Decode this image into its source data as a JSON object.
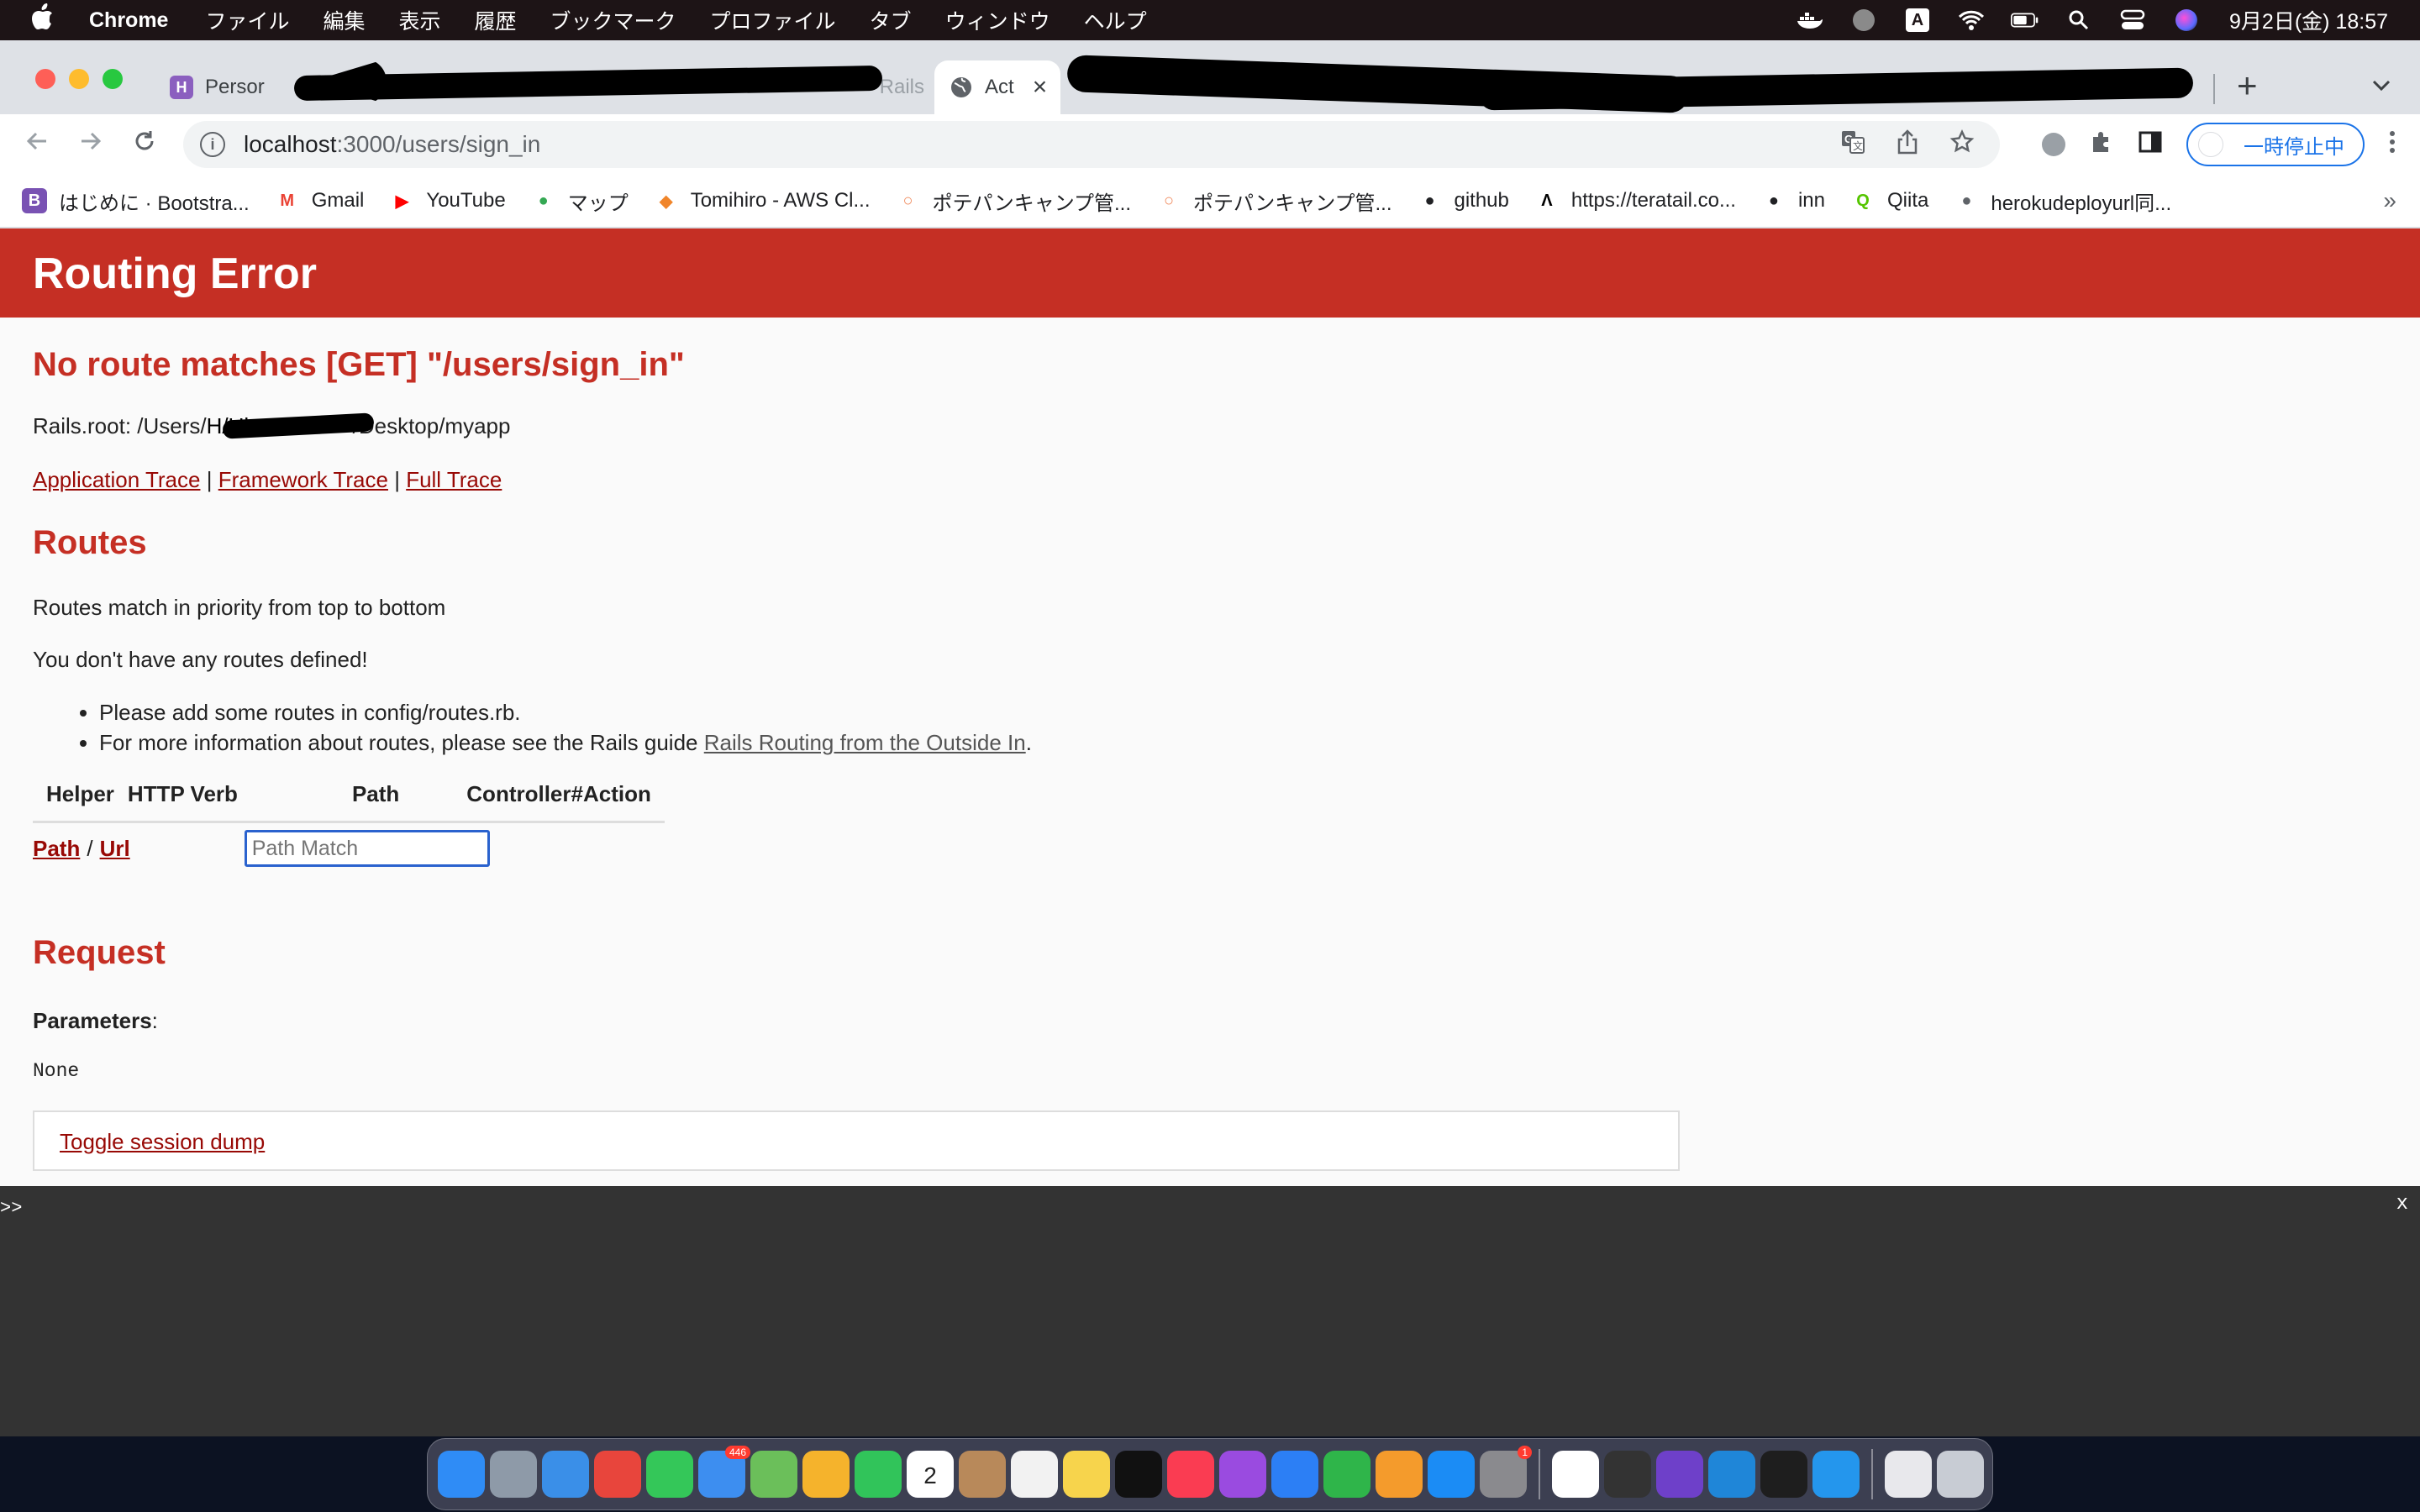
{
  "menubar": {
    "app_name": "Chrome",
    "items": [
      "ファイル",
      "編集",
      "表示",
      "履歴",
      "ブックマーク",
      "プロファイル",
      "タブ",
      "ウィンドウ",
      "ヘルプ"
    ],
    "datetime": "9月2日(金)  18:57",
    "status_icons": [
      "docker-icon",
      "status-circle-icon",
      "input-source-icon",
      "wifi-icon",
      "battery-icon",
      "spotlight-icon",
      "control-center-icon",
      "siri-icon"
    ],
    "input_source": "A"
  },
  "tabs": [
    {
      "label": "Persor",
      "favicon": "H"
    },
    {
      "label": "Rails",
      "favicon": ""
    },
    {
      "label": "Act",
      "favicon": "globe"
    }
  ],
  "address_bar": {
    "host": "localhost",
    "path": ":3000/users/sign_in"
  },
  "profile_button": "一時停止中",
  "bookmarks": [
    {
      "label": "はじめに · Bootstra...",
      "icon": "B",
      "color": "#7952b3"
    },
    {
      "label": "Gmail",
      "icon": "M",
      "color": "#ea4335"
    },
    {
      "label": "YouTube",
      "icon": "▶",
      "color": "#ff0000"
    },
    {
      "label": "マップ",
      "icon": "●",
      "color": "#34a853"
    },
    {
      "label": "Tomihiro - AWS Cl...",
      "icon": "◆",
      "color": "#f0852a"
    },
    {
      "label": "ポテパンキャンプ管...",
      "icon": "○",
      "color": "#f08a5d"
    },
    {
      "label": "ポテパンキャンプ管...",
      "icon": "○",
      "color": "#f08a5d"
    },
    {
      "label": "github",
      "icon": "●",
      "color": "#202124"
    },
    {
      "label": "https://teratail.co...",
      "icon": "Λ",
      "color": "#000000"
    },
    {
      "label": "inn",
      "icon": "●",
      "color": "#202124"
    },
    {
      "label": "Qiita",
      "icon": "Q",
      "color": "#55c500"
    },
    {
      "label": "herokudeployurl同...",
      "icon": "●",
      "color": "#5f6368"
    }
  ],
  "bookmarks_overflow": "»",
  "page": {
    "header": "Routing Error",
    "title": "No route matches [GET] \"/users/sign_in\"",
    "rails_root_prefix": "Rails.root: /Users/",
    "rails_root_mid": "H/Ub",
    "rails_root_suffix": "/Desktop/myapp",
    "trace_links": [
      "Application Trace",
      "Framework Trace",
      "Full Trace"
    ],
    "trace_separator": "|",
    "routes_heading": "Routes",
    "routes_intro": "Routes match in priority from top to bottom",
    "no_routes": "You don't have any routes defined!",
    "bullet1": "Please add some routes in config/routes.rb.",
    "bullet2_prefix": "For more information about routes, please see the Rails guide ",
    "bullet2_link": "Rails Routing from the Outside In",
    "bullet2_suffix": ".",
    "table_headers": [
      "Helper",
      "HTTP Verb",
      "Path",
      "Controller#Action"
    ],
    "helper_path": "Path",
    "helper_sep": "/",
    "helper_url": "Url",
    "path_match_placeholder": "Path Match",
    "request_heading": "Request",
    "parameters_label": "Parameters",
    "parameters_colon": ":",
    "parameters_value": "None",
    "toggle_session": "Toggle session dump"
  },
  "console": {
    "prompt": ">>",
    "close": "x"
  },
  "dock": {
    "apps": [
      {
        "name": "finder-icon",
        "color": "#2f8cf6"
      },
      {
        "name": "launchpad-icon",
        "color": "#8e9aa8"
      },
      {
        "name": "safari-icon",
        "color": "#3a8fe8"
      },
      {
        "name": "chrome-icon",
        "color": "#e8453c"
      },
      {
        "name": "messages-icon",
        "color": "#34c759"
      },
      {
        "name": "mail-icon",
        "color": "#3d8ef0",
        "badge": "446"
      },
      {
        "name": "maps-icon",
        "color": "#6bbf5a"
      },
      {
        "name": "photos-icon",
        "color": "#f5b32c"
      },
      {
        "name": "facetime-icon",
        "color": "#31c45a"
      },
      {
        "name": "calendar-icon",
        "color": "#ffffff",
        "label": "2"
      },
      {
        "name": "contacts-icon",
        "color": "#b8895a"
      },
      {
        "name": "reminders-icon",
        "color": "#f2f2f2"
      },
      {
        "name": "notes-icon",
        "color": "#f7d44c"
      },
      {
        "name": "tv-icon",
        "color": "#111111"
      },
      {
        "name": "music-icon",
        "color": "#fa3c52"
      },
      {
        "name": "podcasts-icon",
        "color": "#9a4be0"
      },
      {
        "name": "keynote-icon",
        "color": "#2c7ff5"
      },
      {
        "name": "numbers-icon",
        "color": "#2fb54a"
      },
      {
        "name": "pages-icon",
        "color": "#f49b2c"
      },
      {
        "name": "app-store-icon",
        "color": "#1b8cf5"
      },
      {
        "name": "system-preferences-icon",
        "color": "#8a8a8e",
        "badge": "1"
      },
      {
        "name": "slack-icon",
        "color": "#ffffff"
      },
      {
        "name": "postman-icon",
        "color": "#333333"
      },
      {
        "name": "github-desktop-icon",
        "color": "#6e40c9"
      },
      {
        "name": "vscode-icon",
        "color": "#1f86d8"
      },
      {
        "name": "terminal-icon",
        "color": "#1e1e1e"
      },
      {
        "name": "docker-icon",
        "color": "#2496ed"
      }
    ],
    "trash": [
      {
        "name": "document-icon",
        "color": "#e8e8ec"
      },
      {
        "name": "trash-icon",
        "color": "#c8ccd4"
      }
    ]
  }
}
